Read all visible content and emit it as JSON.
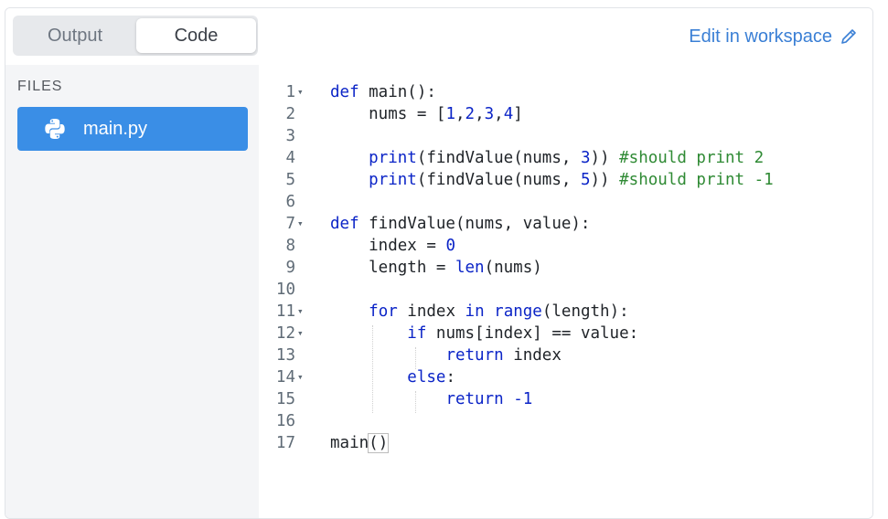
{
  "tabs": [
    {
      "label": "Output",
      "active": false
    },
    {
      "label": "Code",
      "active": true
    }
  ],
  "edit_link": {
    "label": "Edit in workspace",
    "icon": "pencil-icon"
  },
  "sidebar": {
    "title": "FILES",
    "files": [
      {
        "name": "main.py",
        "icon": "python-icon",
        "selected": true
      }
    ]
  },
  "colors": {
    "accent": "#3a8ee6",
    "link": "#3a7fd5",
    "keyword": "#0b24c7",
    "comment": "#2f8a34"
  },
  "code": {
    "lines": [
      {
        "n": "1",
        "fold": true,
        "tokens": [
          [
            "kw",
            "def"
          ],
          [
            "t",
            " main():"
          ]
        ]
      },
      {
        "n": "2",
        "fold": false,
        "tokens": [
          [
            "t",
            "    nums = ["
          ],
          [
            "num",
            "1"
          ],
          [
            "t",
            ","
          ],
          [
            "num",
            "2"
          ],
          [
            "t",
            ","
          ],
          [
            "num",
            "3"
          ],
          [
            "t",
            ","
          ],
          [
            "num",
            "4"
          ],
          [
            "t",
            "]"
          ]
        ]
      },
      {
        "n": "3",
        "fold": false,
        "tokens": []
      },
      {
        "n": "4",
        "fold": false,
        "tokens": [
          [
            "t",
            "    "
          ],
          [
            "fn",
            "print"
          ],
          [
            "t",
            "(findValue(nums, "
          ],
          [
            "num",
            "3"
          ],
          [
            "t",
            ")) "
          ],
          [
            "cm",
            "#should print 2"
          ]
        ]
      },
      {
        "n": "5",
        "fold": false,
        "tokens": [
          [
            "t",
            "    "
          ],
          [
            "fn",
            "print"
          ],
          [
            "t",
            "(findValue(nums, "
          ],
          [
            "num",
            "5"
          ],
          [
            "t",
            ")) "
          ],
          [
            "cm",
            "#should print -1"
          ]
        ]
      },
      {
        "n": "6",
        "fold": false,
        "tokens": []
      },
      {
        "n": "7",
        "fold": true,
        "tokens": [
          [
            "kw",
            "def"
          ],
          [
            "t",
            " findValue(nums, value):"
          ]
        ]
      },
      {
        "n": "8",
        "fold": false,
        "tokens": [
          [
            "t",
            "    index = "
          ],
          [
            "num",
            "0"
          ]
        ]
      },
      {
        "n": "9",
        "fold": false,
        "tokens": [
          [
            "t",
            "    length = "
          ],
          [
            "fn",
            "len"
          ],
          [
            "t",
            "(nums)"
          ]
        ]
      },
      {
        "n": "10",
        "fold": false,
        "tokens": []
      },
      {
        "n": "11",
        "fold": true,
        "tokens": [
          [
            "t",
            "    "
          ],
          [
            "kw",
            "for"
          ],
          [
            "t",
            " index "
          ],
          [
            "kw",
            "in"
          ],
          [
            "t",
            " "
          ],
          [
            "fn",
            "range"
          ],
          [
            "t",
            "(length):"
          ]
        ]
      },
      {
        "n": "12",
        "fold": true,
        "tokens": [
          [
            "t",
            "        "
          ],
          [
            "kw",
            "if"
          ],
          [
            "t",
            " nums[index] == value:"
          ]
        ]
      },
      {
        "n": "13",
        "fold": false,
        "tokens": [
          [
            "t",
            "            "
          ],
          [
            "kw",
            "return"
          ],
          [
            "t",
            " index"
          ]
        ]
      },
      {
        "n": "14",
        "fold": true,
        "tokens": [
          [
            "t",
            "        "
          ],
          [
            "kw",
            "else"
          ],
          [
            "t",
            ":"
          ]
        ]
      },
      {
        "n": "15",
        "fold": false,
        "tokens": [
          [
            "t",
            "            "
          ],
          [
            "kw",
            "return"
          ],
          [
            "t",
            " "
          ],
          [
            "num",
            "-1"
          ]
        ]
      },
      {
        "n": "16",
        "fold": false,
        "tokens": []
      },
      {
        "n": "17",
        "fold": false,
        "tokens": [
          [
            "t",
            "main"
          ],
          [
            "box",
            "()"
          ]
        ]
      }
    ]
  }
}
